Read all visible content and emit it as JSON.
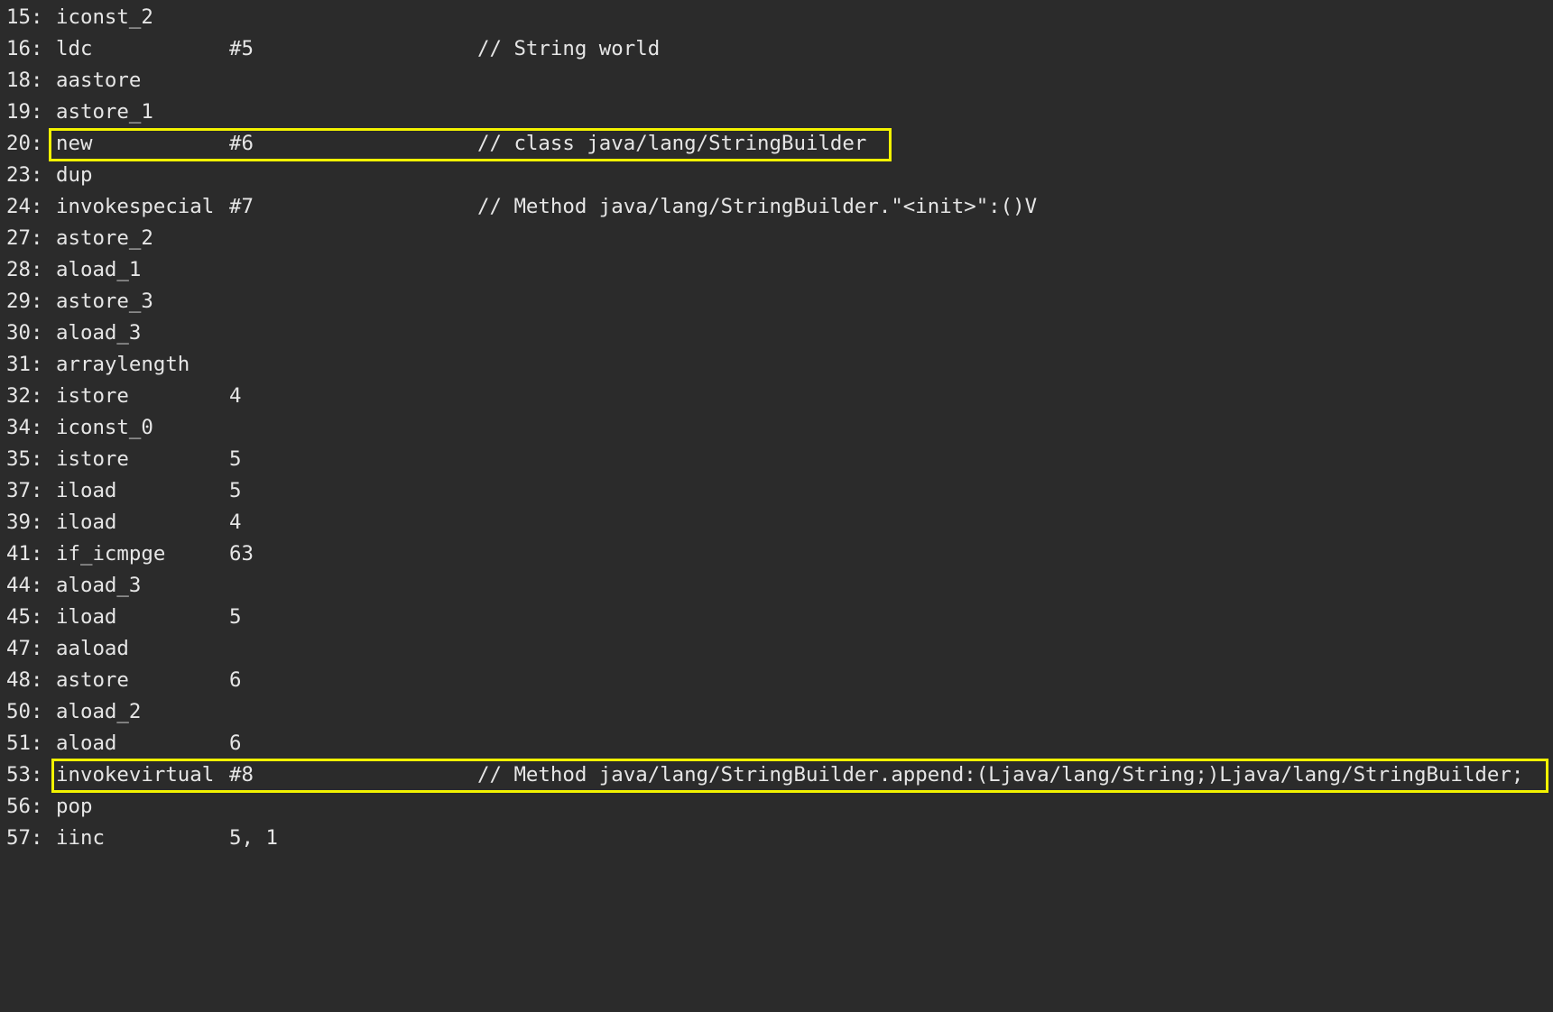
{
  "editor": {
    "accent_color": "#f2f200",
    "background_color": "#2b2b2b",
    "lines": [
      {
        "offset": "15:",
        "op": "iconst_2",
        "arg": "",
        "comment": ""
      },
      {
        "offset": "16:",
        "op": "ldc",
        "arg": "#5",
        "comment": "// String world"
      },
      {
        "offset": "18:",
        "op": "aastore",
        "arg": "",
        "comment": ""
      },
      {
        "offset": "19:",
        "op": "astore_1",
        "arg": "",
        "comment": ""
      },
      {
        "offset": "20:",
        "op": "new",
        "arg": "#6",
        "comment": "// class java/lang/StringBuilder"
      },
      {
        "offset": "23:",
        "op": "dup",
        "arg": "",
        "comment": ""
      },
      {
        "offset": "24:",
        "op": "invokespecial",
        "arg": "#7",
        "comment": "// Method java/lang/StringBuilder.\"<init>\":()V"
      },
      {
        "offset": "27:",
        "op": "astore_2",
        "arg": "",
        "comment": ""
      },
      {
        "offset": "28:",
        "op": "aload_1",
        "arg": "",
        "comment": ""
      },
      {
        "offset": "29:",
        "op": "astore_3",
        "arg": "",
        "comment": ""
      },
      {
        "offset": "30:",
        "op": "aload_3",
        "arg": "",
        "comment": ""
      },
      {
        "offset": "31:",
        "op": "arraylength",
        "arg": "",
        "comment": ""
      },
      {
        "offset": "32:",
        "op": "istore",
        "arg": "4",
        "comment": ""
      },
      {
        "offset": "34:",
        "op": "iconst_0",
        "arg": "",
        "comment": ""
      },
      {
        "offset": "35:",
        "op": "istore",
        "arg": "5",
        "comment": ""
      },
      {
        "offset": "37:",
        "op": "iload",
        "arg": "5",
        "comment": ""
      },
      {
        "offset": "39:",
        "op": "iload",
        "arg": "4",
        "comment": ""
      },
      {
        "offset": "41:",
        "op": "if_icmpge",
        "arg": "63",
        "comment": ""
      },
      {
        "offset": "44:",
        "op": "aload_3",
        "arg": "",
        "comment": ""
      },
      {
        "offset": "45:",
        "op": "iload",
        "arg": "5",
        "comment": ""
      },
      {
        "offset": "47:",
        "op": "aaload",
        "arg": "",
        "comment": ""
      },
      {
        "offset": "48:",
        "op": "astore",
        "arg": "6",
        "comment": ""
      },
      {
        "offset": "50:",
        "op": "aload_2",
        "arg": "",
        "comment": ""
      },
      {
        "offset": "51:",
        "op": "aload",
        "arg": "6",
        "comment": ""
      },
      {
        "offset": "53:",
        "op": "invokevirtual",
        "arg": "#8",
        "comment": "// Method java/lang/StringBuilder.append:(Ljava/lang/String;)Ljava/lang/StringBuilder;"
      },
      {
        "offset": "56:",
        "op": "pop",
        "arg": "",
        "comment": ""
      },
      {
        "offset": "57:",
        "op": "iinc",
        "arg": "5, 1",
        "comment": ""
      }
    ]
  }
}
